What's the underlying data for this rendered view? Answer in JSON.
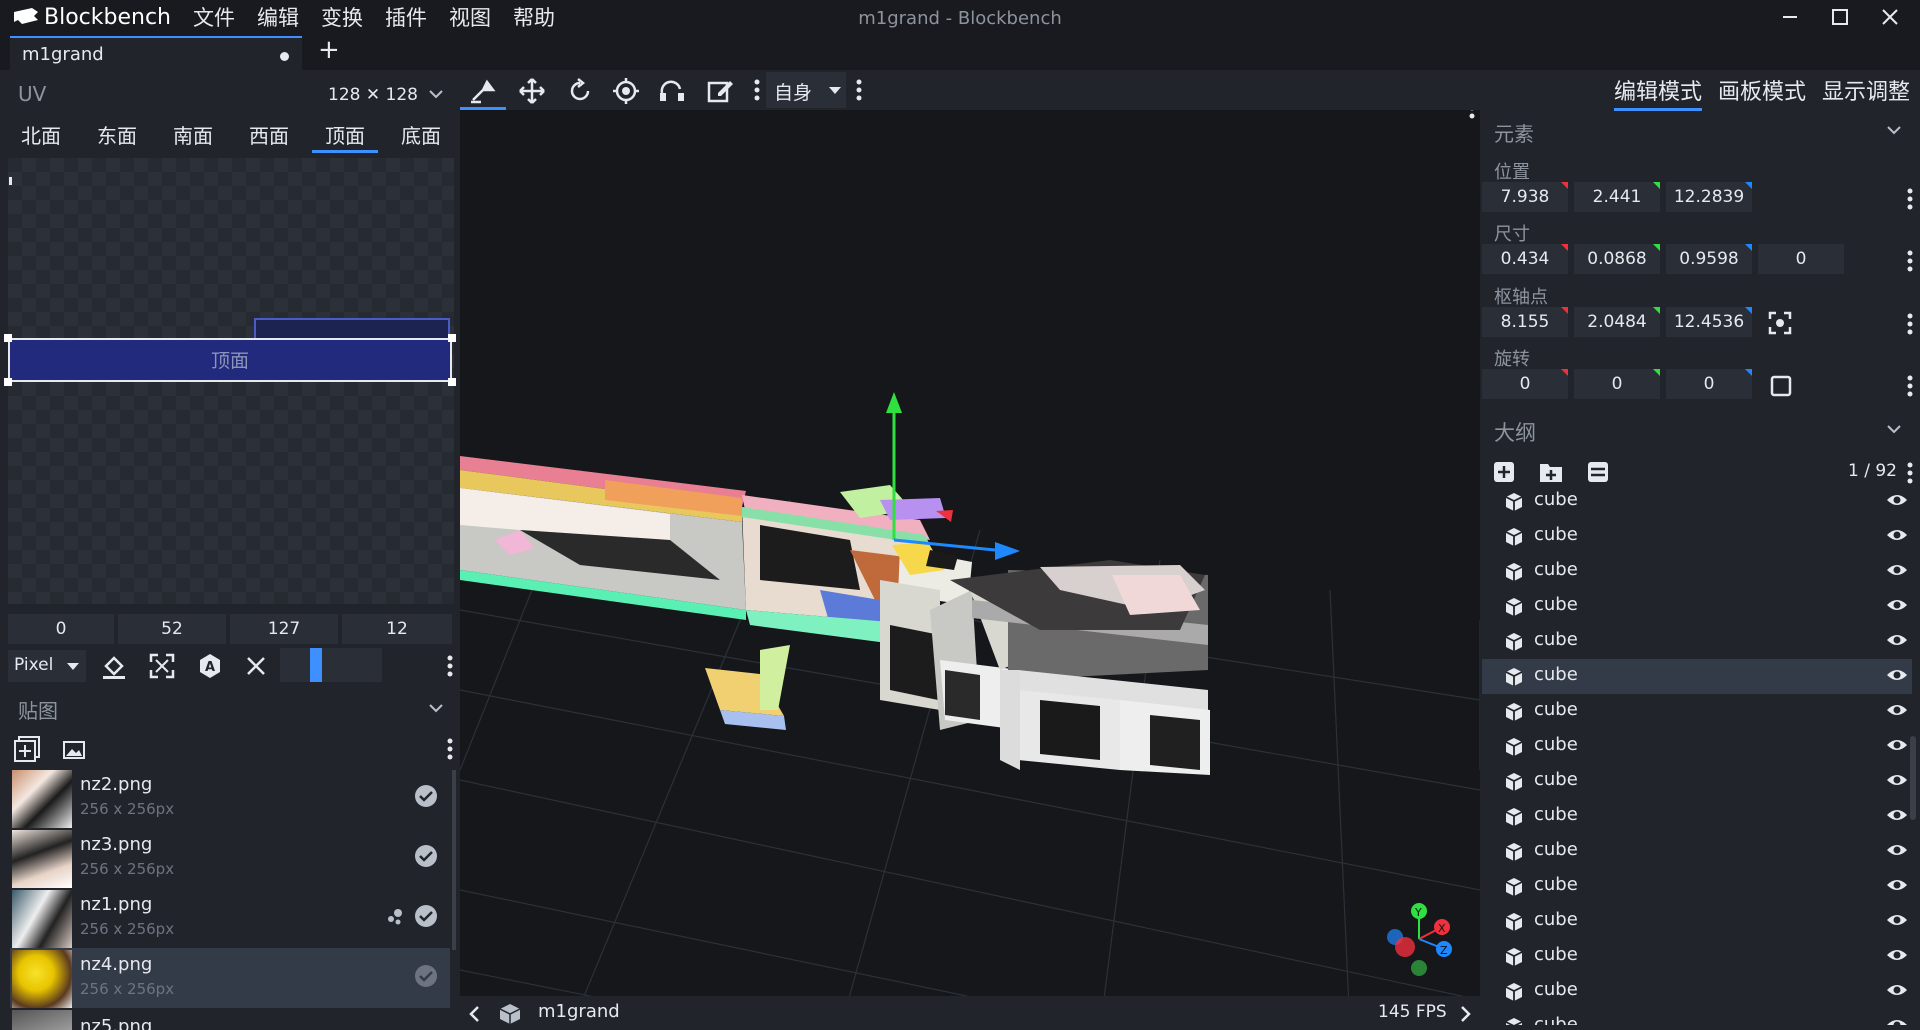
{
  "app": {
    "brand": "Blockbench",
    "window_title": "m1grand - Blockbench",
    "menu": [
      "文件",
      "编辑",
      "变换",
      "插件",
      "视图",
      "帮助"
    ]
  },
  "tabs": {
    "project": "m1grand",
    "add_label": "+"
  },
  "uv": {
    "title": "UV",
    "resolution": "128 ✕ 128",
    "faces": [
      "北面",
      "东面",
      "南面",
      "西面",
      "顶面",
      "底面"
    ],
    "active_face": "顶面",
    "face_label": "顶面",
    "values": [
      "0",
      "52",
      "127",
      "12"
    ],
    "mode": "Pixel"
  },
  "textures": {
    "title": "贴图",
    "items": [
      {
        "name": "nz2.png",
        "size": "256 x 256px"
      },
      {
        "name": "nz3.png",
        "size": "256 x 256px"
      },
      {
        "name": "nz1.png",
        "size": "256 x 256px"
      },
      {
        "name": "nz4.png",
        "size": "256 x 256px"
      },
      {
        "name": "nz5.png",
        "size": ""
      }
    ]
  },
  "viewport": {
    "space_mode": "自身",
    "model_name": "m1grand",
    "fps": "145 FPS",
    "axes": {
      "y": "Y",
      "x": "X",
      "z": "Z"
    }
  },
  "modes": [
    "编辑模式",
    "画板模式",
    "显示调整"
  ],
  "element": {
    "title": "元素",
    "position_label": "位置",
    "position": [
      "7.938",
      "2.441",
      "12.2839"
    ],
    "size_label": "尺寸",
    "size": [
      "0.434",
      "0.0868",
      "0.9598",
      "0"
    ],
    "pivot_label": "枢轴点",
    "pivot": [
      "8.155",
      "2.0484",
      "12.4536"
    ],
    "rotation_label": "旋转",
    "rotation": [
      "0",
      "0",
      "0"
    ]
  },
  "outliner": {
    "title": "大纲",
    "count": "1 / 92",
    "items": [
      "cube",
      "cube",
      "cube",
      "cube",
      "cube",
      "cube",
      "cube",
      "cube",
      "cube",
      "cube",
      "cube",
      "cube",
      "cube",
      "cube",
      "cube",
      "cube"
    ]
  },
  "colors": {
    "accent": "#3e90ff",
    "x_axis": "#f0303c",
    "y_axis": "#30e040",
    "z_axis": "#1e88ff"
  }
}
